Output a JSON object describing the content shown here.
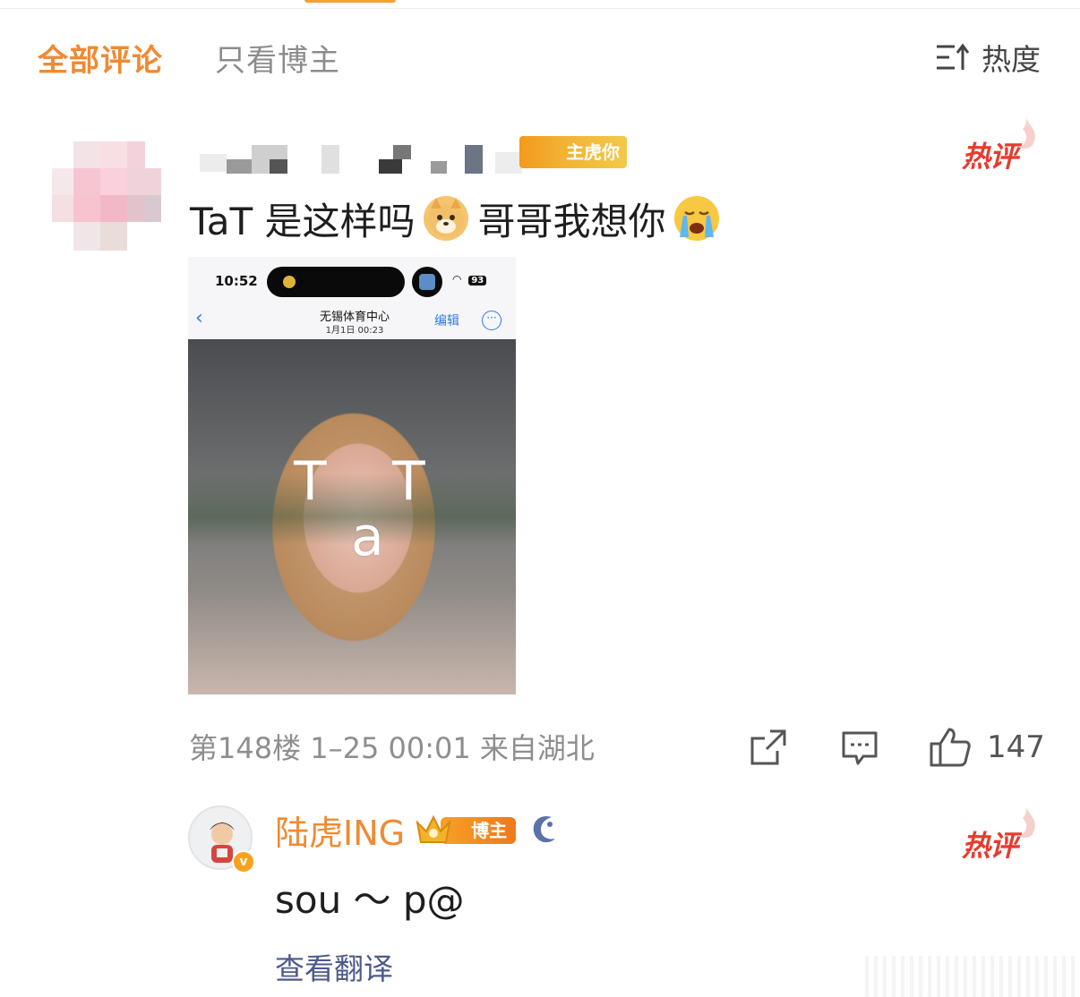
{
  "tabs": {
    "all_comments": "全部评论",
    "author_only": "只看博主"
  },
  "sort": {
    "icon": "sort-lines-icon",
    "label": "热度"
  },
  "comment1": {
    "badge_text": "主虎你",
    "hot_label": "热评",
    "text_a": "TaT 是这样吗",
    "emoji_a": "dog-emoji",
    "text_b": "哥哥我想你",
    "emoji_b": "crying-emoji",
    "photo": {
      "time": "10:52",
      "battery": "93",
      "title": "无锡体育中心",
      "subtitle": "1月1日  00:23",
      "edit": "编辑",
      "back": "‹",
      "more": "···",
      "overlay_t1": "T",
      "overlay_a": "a",
      "overlay_t2": "T"
    },
    "meta": "第148楼 1–25 00:01 来自湖北",
    "like_count": "147"
  },
  "reply": {
    "username": "陆虎ING",
    "badge_label": "博主",
    "verified_mark": "v",
    "hot_label": "热评",
    "text": "sou ～ p@",
    "translate": "查看翻译"
  },
  "colors": {
    "accent": "#f08a32",
    "hot": "#e63b2e",
    "link": "#4d5a8c",
    "muted": "#8e8e8e"
  }
}
